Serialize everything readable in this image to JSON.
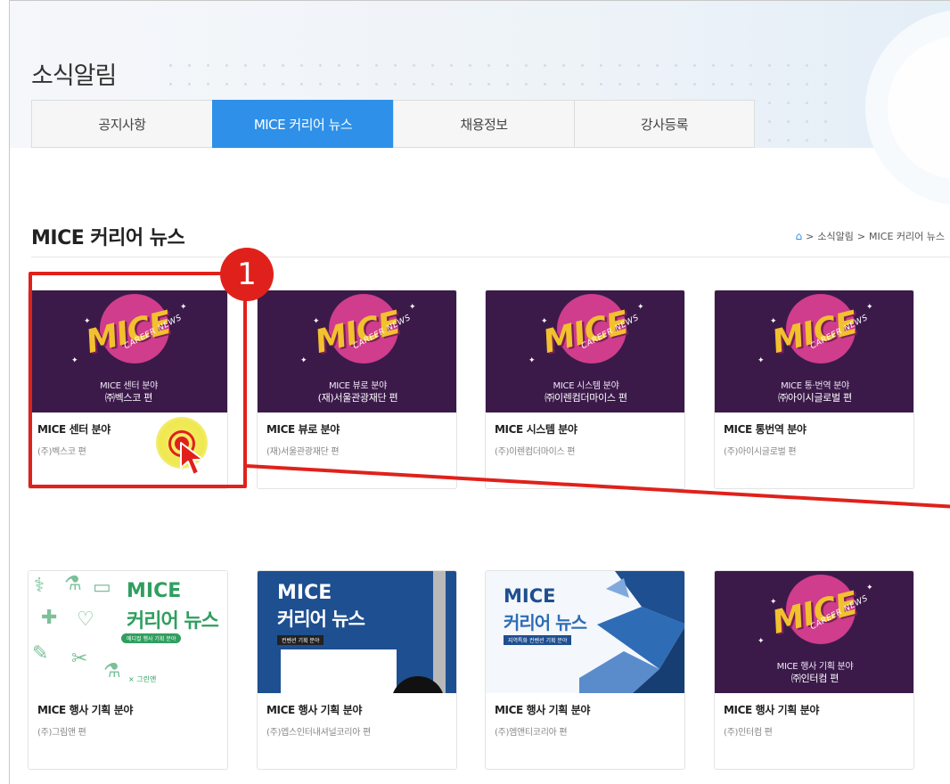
{
  "header": {
    "section_title": "소식알림",
    "tabs": [
      {
        "label": "공지사항",
        "active": false
      },
      {
        "label": "MICE 커리어 뉴스",
        "active": true
      },
      {
        "label": "채용정보",
        "active": false
      },
      {
        "label": "강사등록",
        "active": false
      }
    ]
  },
  "page": {
    "heading": "MICE 커리어 뉴스",
    "breadcrumb": [
      "소식알림",
      "MICE 커리어 뉴스"
    ]
  },
  "thumb_text": {
    "mice": "MICE",
    "career_news": "CAREER NEWS",
    "mice_career_news_line1": "MICE",
    "mice_career_news_line2": "커리어 뉴스",
    "green_pill": "메디컬 행사 기획 분야",
    "green_footer": "× 그린앤",
    "navy_pill": "컨벤션 기획 분야",
    "blue_pill": "지역특화 컨벤션 기획 분야"
  },
  "cards": [
    {
      "title": "MICE 센터 분야",
      "subtitle": "(주)벡스코 편",
      "thumb_line1": "MICE 센터 분야",
      "thumb_line2": "㈜벡스코 편"
    },
    {
      "title": "MICE 뷰로 분야",
      "subtitle": "(재)서울관광재단 편",
      "thumb_line1": "MICE 뷰로 분야",
      "thumb_line2": "(재)서울관광재단 편"
    },
    {
      "title": "MICE 시스템 분야",
      "subtitle": "(주)이렌컴더마이스 편",
      "thumb_line1": "MICE 시스템 분야",
      "thumb_line2": "㈜이렌컴더마이스 편"
    },
    {
      "title": "MICE 통번역 분야",
      "subtitle": "(주)아이시글로벌 편",
      "thumb_line1": "MICE 통·번역 분야",
      "thumb_line2": "㈜아이시글로벌 편"
    },
    {
      "title": "MICE 행사 기획 분야",
      "subtitle": "(주)그림앤 편"
    },
    {
      "title": "MICE 행사 기획 분야",
      "subtitle": "(주)엡스인터내셔널코리아 편"
    },
    {
      "title": "MICE 행사 기획 분야",
      "subtitle": "(주)엠앤티코리아 편"
    },
    {
      "title": "MICE 행사 기획 분야",
      "subtitle": "(주)인터컴 편",
      "thumb_line1": "MICE 행사 기획 분야",
      "thumb_line2": "㈜인터컴 편"
    }
  ],
  "annotation": {
    "step_number": "1"
  },
  "colors": {
    "accent": "#2e90e8",
    "highlight": "#e0211b",
    "thumb_purple": "#3b1a4a",
    "thumb_pink": "#cf3d8c",
    "thumb_yellow": "#f2c12e"
  }
}
